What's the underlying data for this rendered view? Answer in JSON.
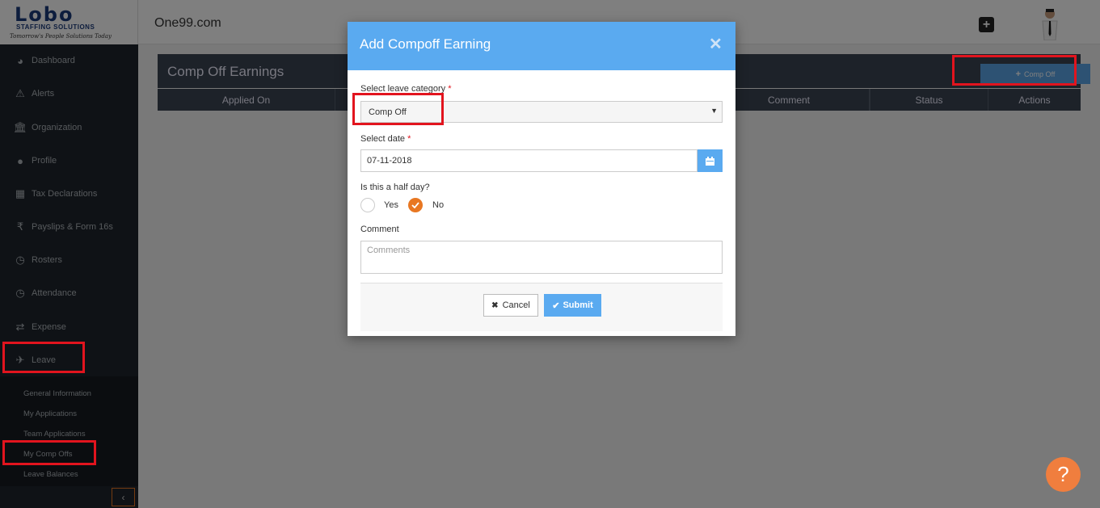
{
  "app": {
    "site_title": "One99.com",
    "logo_text": "Lobo",
    "logo_subtitle": "STAFFING SOLUTIONS",
    "logo_tagline": "Tomorrow's People Solutions Today"
  },
  "sidebar": {
    "items": [
      {
        "label": "Dashboard",
        "icon": "dashboard-icon"
      },
      {
        "label": "Alerts",
        "icon": "warning-icon"
      },
      {
        "label": "Organization",
        "icon": "bank-icon"
      },
      {
        "label": "Profile",
        "icon": "user-icon"
      },
      {
        "label": "Tax Declarations",
        "icon": "calculator-icon"
      },
      {
        "label": "Payslips & Form 16s",
        "icon": "rupee-icon"
      },
      {
        "label": "Rosters",
        "icon": "clock-icon"
      },
      {
        "label": "Attendance",
        "icon": "clock-icon"
      },
      {
        "label": "Expense",
        "icon": "exchange-icon"
      },
      {
        "label": "Leave",
        "icon": "plane-icon"
      }
    ],
    "leave_subitems": [
      "General Information",
      "My Applications",
      "Team Applications",
      "My Comp Offs",
      "Leave Balances"
    ],
    "collapse_icon": "chevron-left-icon"
  },
  "main": {
    "panel_title": "Comp Off Earnings",
    "add_button_label": "Comp Off",
    "table_headers": [
      "Applied On",
      "Comment",
      "Status",
      "Actions"
    ]
  },
  "modal": {
    "title": "Add Compoff Earning",
    "category_label": "Select leave category",
    "category_value": "Comp Off",
    "date_label": "Select date",
    "date_value": "07-11-2018",
    "half_day_label": "Is this a half day?",
    "half_day_options": [
      "Yes",
      "No"
    ],
    "half_day_selected": "No",
    "comment_label": "Comment",
    "comment_placeholder": "Comments",
    "cancel_label": "Cancel",
    "submit_label": "Submit",
    "required_mark": "*"
  },
  "help": {
    "label": "?"
  },
  "colors": {
    "sidebar_bg": "#1f252c",
    "accent_blue": "#5aaaf0",
    "accent_orange": "#e87722",
    "highlight_red": "#e2141e"
  }
}
